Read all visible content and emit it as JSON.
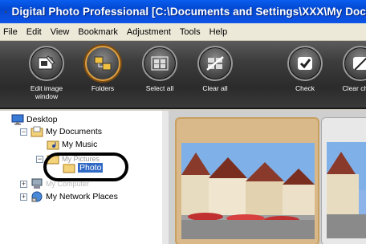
{
  "window": {
    "title": "Digital Photo Professional  [C:\\Documents and Settings\\XXX\\My Doc",
    "icon": "camera-app-icon"
  },
  "menu": {
    "items": [
      "File",
      "Edit",
      "View",
      "Bookmark",
      "Adjustment",
      "Tools",
      "Help"
    ]
  },
  "toolbar": {
    "buttons": [
      {
        "label": "Edit image window",
        "icon": "edit-image-icon"
      },
      {
        "label": "Folders",
        "icon": "folders-icon"
      },
      {
        "label": "Select all",
        "icon": "select-all-icon"
      },
      {
        "label": "Clear all",
        "icon": "clear-all-icon"
      },
      {
        "label": "Check",
        "icon": "check-icon"
      },
      {
        "label": "Clear check",
        "icon": "clear-check-icon"
      }
    ]
  },
  "tree": {
    "desktop": "Desktop",
    "my_documents": "My Documents",
    "my_music": "My Music",
    "my_pictures": "My Pictures",
    "photo": "Photo",
    "my_computer": "My Computer",
    "my_network": "My Network Places"
  },
  "colors": {
    "titlebar": "#0a4fe0",
    "selection": "#316ac5",
    "toolbar": "#3d3d3d"
  }
}
